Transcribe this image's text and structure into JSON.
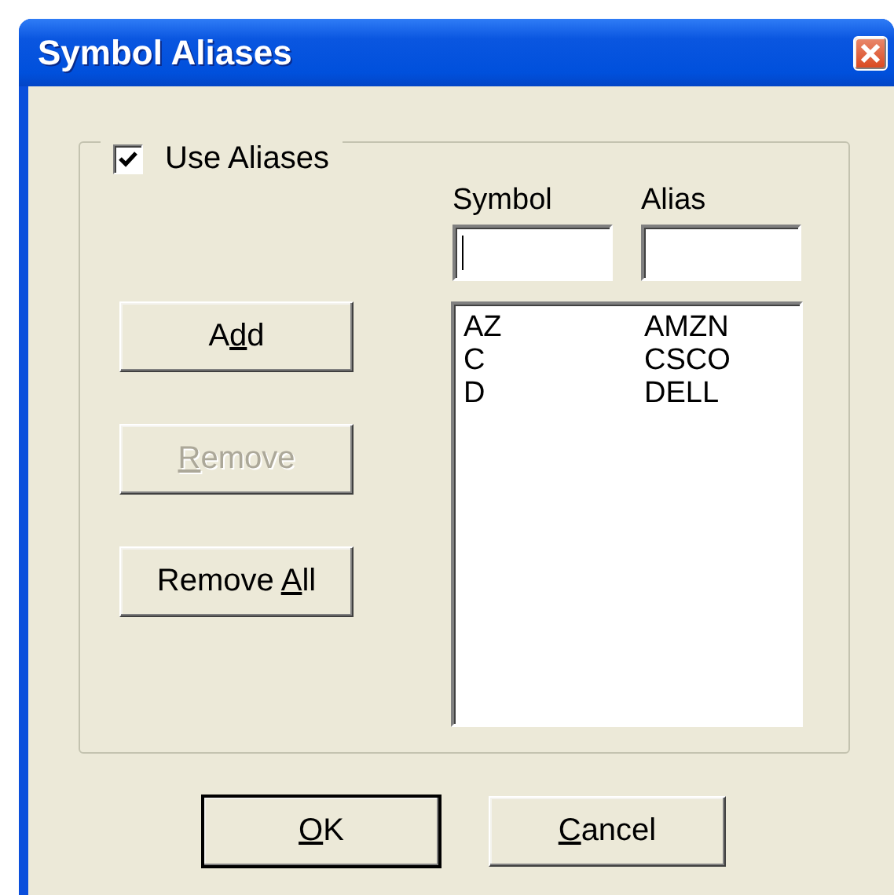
{
  "window": {
    "title": "Symbol Aliases"
  },
  "use_aliases": {
    "label": "Use Aliases",
    "checked": true
  },
  "fields": [
    {
      "label": "Symbol",
      "focused": true
    },
    {
      "label": "Alias",
      "focused": false
    }
  ],
  "buttons": [
    {
      "label_start": "A",
      "access_key": "d",
      "label_end": "d",
      "disabled": false
    },
    {
      "access_key": "R",
      "label_end": "emove",
      "disabled": true
    },
    {
      "label_start": "Remove ",
      "access_key": "A",
      "label_end": "ll",
      "disabled": false
    }
  ],
  "aliases": [
    {
      "symbol": "AZ",
      "alias": "AMZN"
    },
    {
      "symbol": "C",
      "alias": "CSCO"
    },
    {
      "symbol": "D",
      "alias": "DELL"
    }
  ],
  "dialog_buttons": [
    {
      "access_key": "O",
      "label_end": "K",
      "default": true
    },
    {
      "access_key": "C",
      "label_end": "ancel",
      "default": false
    }
  ]
}
